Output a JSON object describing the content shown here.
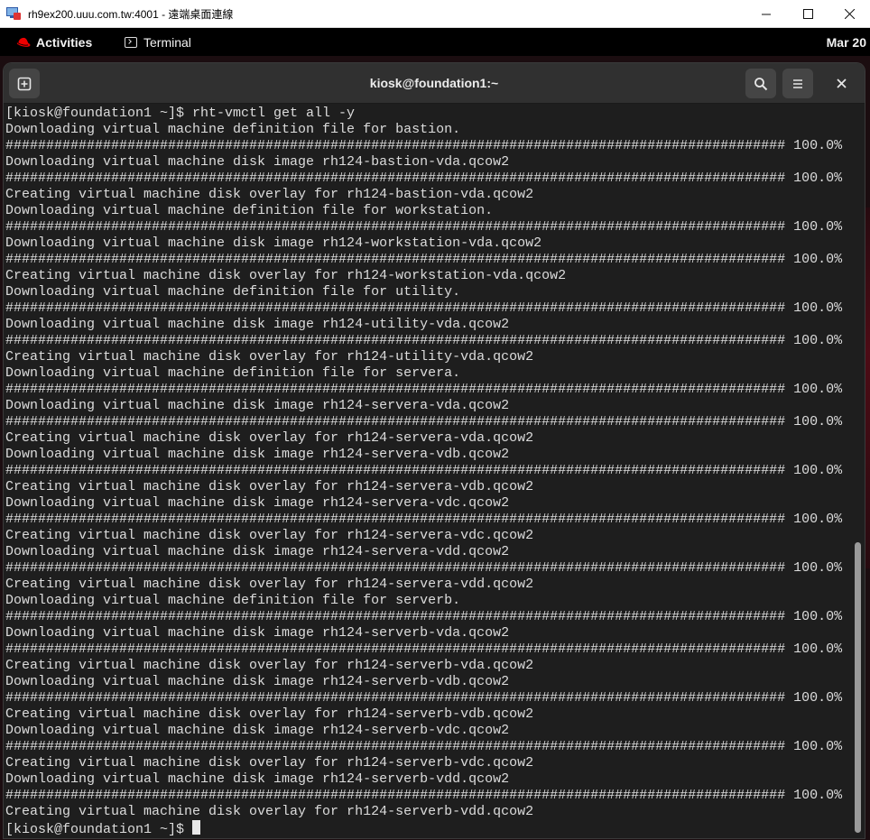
{
  "window": {
    "title": "rh9ex200.uuu.com.tw:4001 - 遠端桌面連線",
    "minimize": "minimize",
    "maximize": "maximize",
    "close": "close"
  },
  "topbar": {
    "activities": "Activities",
    "app": "Terminal",
    "clock": "Mar 20"
  },
  "terminal": {
    "title": "kiosk@foundation1:~",
    "prompt": "[kiosk@foundation1 ~]$ ",
    "lines": [
      "[kiosk@foundation1 ~]$ rht-vmctl get all -y",
      "Downloading virtual machine definition file for bastion.",
      "################################################################################################ 100.0%",
      "Downloading virtual machine disk image rh124-bastion-vda.qcow2",
      "################################################################################################ 100.0%",
      "Creating virtual machine disk overlay for rh124-bastion-vda.qcow2",
      "Downloading virtual machine definition file for workstation.",
      "################################################################################################ 100.0%",
      "Downloading virtual machine disk image rh124-workstation-vda.qcow2",
      "################################################################################################ 100.0%",
      "Creating virtual machine disk overlay for rh124-workstation-vda.qcow2",
      "Downloading virtual machine definition file for utility.",
      "################################################################################################ 100.0%",
      "Downloading virtual machine disk image rh124-utility-vda.qcow2",
      "################################################################################################ 100.0%",
      "Creating virtual machine disk overlay for rh124-utility-vda.qcow2",
      "Downloading virtual machine definition file for servera.",
      "################################################################################################ 100.0%",
      "Downloading virtual machine disk image rh124-servera-vda.qcow2",
      "################################################################################################ 100.0%",
      "Creating virtual machine disk overlay for rh124-servera-vda.qcow2",
      "Downloading virtual machine disk image rh124-servera-vdb.qcow2",
      "################################################################################################ 100.0%",
      "Creating virtual machine disk overlay for rh124-servera-vdb.qcow2",
      "Downloading virtual machine disk image rh124-servera-vdc.qcow2",
      "################################################################################################ 100.0%",
      "Creating virtual machine disk overlay for rh124-servera-vdc.qcow2",
      "Downloading virtual machine disk image rh124-servera-vdd.qcow2",
      "################################################################################################ 100.0%",
      "Creating virtual machine disk overlay for rh124-servera-vdd.qcow2",
      "Downloading virtual machine definition file for serverb.",
      "################################################################################################ 100.0%",
      "Downloading virtual machine disk image rh124-serverb-vda.qcow2",
      "################################################################################################ 100.0%",
      "Creating virtual machine disk overlay for rh124-serverb-vda.qcow2",
      "Downloading virtual machine disk image rh124-serverb-vdb.qcow2",
      "################################################################################################ 100.0%",
      "Creating virtual machine disk overlay for rh124-serverb-vdb.qcow2",
      "Downloading virtual machine disk image rh124-serverb-vdc.qcow2",
      "################################################################################################ 100.0%",
      "Creating virtual machine disk overlay for rh124-serverb-vdc.qcow2",
      "Downloading virtual machine disk image rh124-serverb-vdd.qcow2",
      "################################################################################################ 100.0%",
      "Creating virtual machine disk overlay for rh124-serverb-vdd.qcow2"
    ]
  },
  "icons": {
    "new_tab": "new-tab-icon",
    "search": "search-icon",
    "menu": "hamburger-menu-icon",
    "close": "close-icon"
  },
  "colors": {
    "terminal_bg": "#1e1e1e",
    "header_bg": "#303030",
    "text": "#dcdcdc",
    "gnome_bar": "#000000",
    "redhat": "#ee0000"
  }
}
